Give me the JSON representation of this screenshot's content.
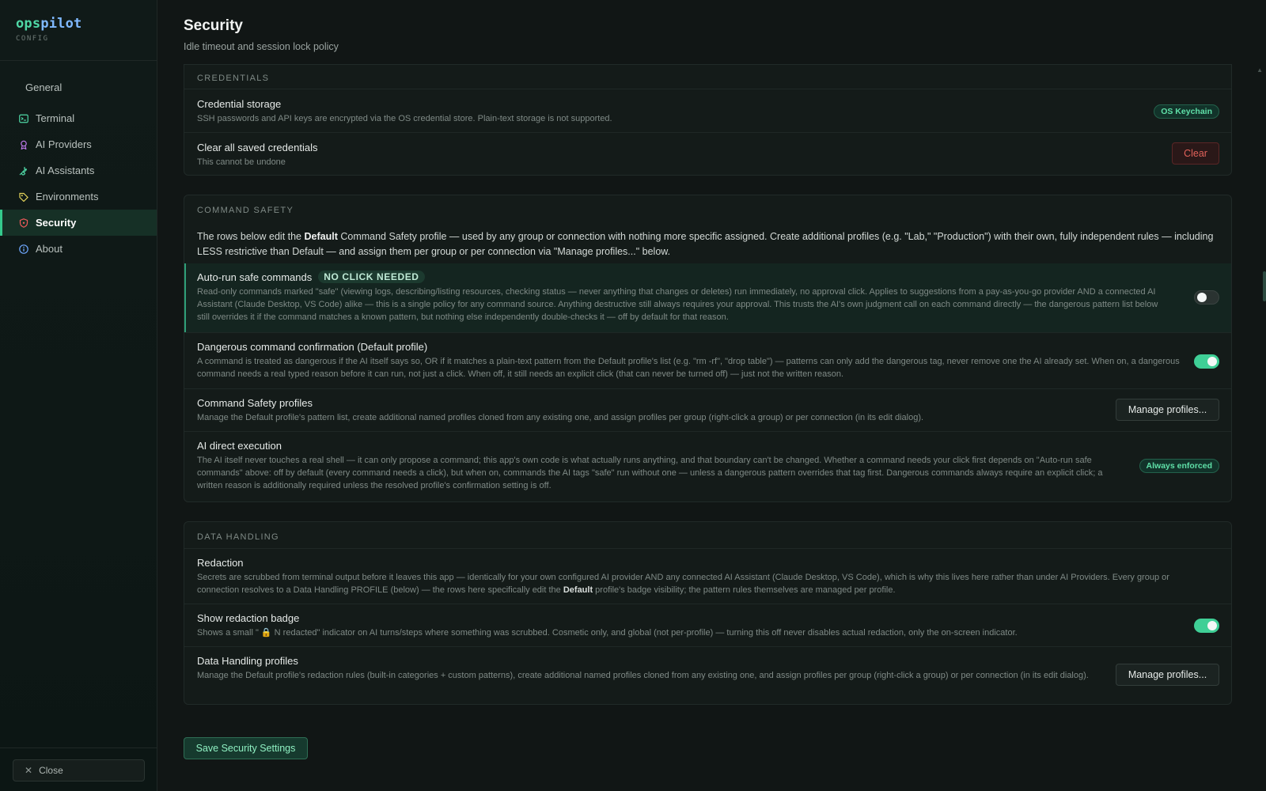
{
  "brand": {
    "name_a": "ops",
    "name_b": "pilot",
    "sub": "CONFIG"
  },
  "nav": {
    "general": "General",
    "items": [
      {
        "label": "Terminal",
        "icon": "terminal-icon",
        "color": "#4fd8a6"
      },
      {
        "label": "AI Providers",
        "icon": "ribbon-icon",
        "color": "#c27bf0"
      },
      {
        "label": "AI Assistants",
        "icon": "plug-icon",
        "color": "#4fd8a6"
      },
      {
        "label": "Environments",
        "icon": "tag-icon",
        "color": "#e3d35a"
      },
      {
        "label": "Security",
        "icon": "shield-icon",
        "color": "#ef5a5a",
        "active": true
      },
      {
        "label": "About",
        "icon": "info-icon",
        "color": "#6fa8ff"
      }
    ],
    "close": "Close"
  },
  "header": {
    "title": "Security",
    "subtitle": "Idle timeout and session lock policy"
  },
  "credentials": {
    "heading": "CREDENTIALS",
    "storage_title": "Credential storage",
    "storage_desc": "SSH passwords and API keys are encrypted via the OS credential store. Plain-text storage is not supported.",
    "storage_badge": "OS Keychain",
    "clear_title": "Clear all saved credentials",
    "clear_desc": "This cannot be undone",
    "clear_button": "Clear"
  },
  "command_safety": {
    "heading": "COMMAND SAFETY",
    "intro_a": "The rows below edit the ",
    "intro_bold": "Default",
    "intro_b": " Command Safety profile — used by any group or connection with nothing more specific assigned. Create additional profiles (e.g. \"Lab,\" \"Production\") with their own, fully independent rules — including LESS restrictive than Default — and assign them per group or per connection via \"Manage profiles...\" below.",
    "autorun_title": "Auto-run safe commands",
    "autorun_pill": "NO CLICK NEEDED",
    "autorun_desc": "Read-only commands marked \"safe\" (viewing logs, describing/listing resources, checking status — never anything that changes or deletes) run immediately, no approval click. Applies to suggestions from a pay-as-you-go provider AND a connected AI Assistant (Claude Desktop, VS Code) alike — this is a single policy for any command source. Anything destructive still always requires your approval. This trusts the AI's own judgment call on each command directly — the dangerous pattern list below still overrides it if the command matches a known pattern, but nothing else independently double-checks it — off by default for that reason.",
    "autorun_on": false,
    "danger_title": "Dangerous command confirmation (Default profile)",
    "danger_desc": "A command is treated as dangerous if the AI itself says so, OR if it matches a plain-text pattern from the Default profile's list (e.g. \"rm -rf\", \"drop table\") — patterns can only add the dangerous tag, never remove one the AI already set. When on, a dangerous command needs a real typed reason before it can run, not just a click. When off, it still needs an explicit click (that can never be turned off) — just not the written reason.",
    "danger_on": true,
    "profiles_title": "Command Safety profiles",
    "profiles_desc": "Manage the Default profile's pattern list, create additional named profiles cloned from any existing one, and assign profiles per group (right-click a group) or per connection (in its edit dialog).",
    "profiles_button": "Manage profiles...",
    "direct_title": "AI direct execution",
    "direct_desc": "The AI itself never touches a real shell — it can only propose a command; this app's own code is what actually runs anything, and that boundary can't be changed. Whether a command needs your click first depends on \"Auto-run safe commands\" above: off by default (every command needs a click), but when on, commands the AI tags \"safe\" run without one — unless a dangerous pattern overrides that tag first. Dangerous commands always require an explicit click; a written reason is additionally required unless the resolved profile's confirmation setting is off.",
    "direct_badge": "Always enforced"
  },
  "data_handling": {
    "heading": "DATA HANDLING",
    "redaction_title": "Redaction",
    "redaction_desc_a": "Secrets are scrubbed from terminal output before it leaves this app — identically for your own configured AI provider AND any connected AI Assistant (Claude Desktop, VS Code), which is why this lives here rather than under AI Providers. Every group or connection resolves to a Data Handling PROFILE (below) — the rows here specifically edit the ",
    "redaction_bold": "Default",
    "redaction_desc_b": " profile's badge visibility; the pattern rules themselves are managed per profile.",
    "badge_title": "Show redaction badge",
    "badge_desc": "Shows a small \" 🔒 N redacted\" indicator on AI turns/steps where something was scrubbed. Cosmetic only, and global (not per-profile) — turning this off never disables actual redaction, only the on-screen indicator.",
    "badge_on": true,
    "profiles_title": "Data Handling profiles",
    "profiles_desc": "Manage the Default profile's redaction rules (built-in categories + custom patterns), create additional named profiles cloned from any existing one, and assign profiles per group (right-click a group) or per connection (in its edit dialog).",
    "profiles_button": "Manage profiles..."
  },
  "save_button": "Save Security Settings"
}
